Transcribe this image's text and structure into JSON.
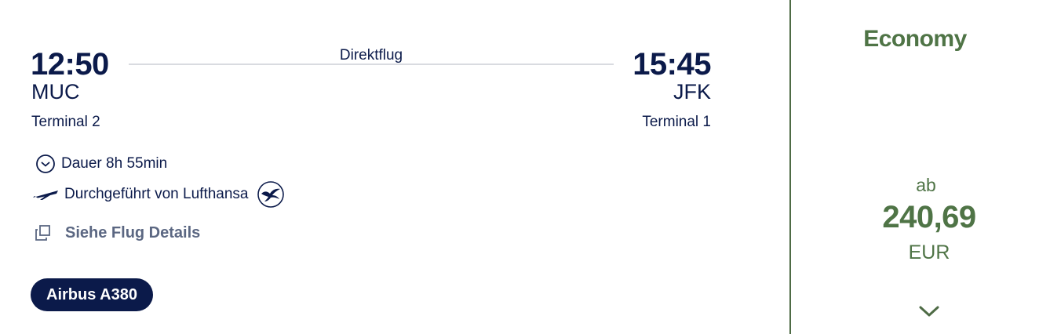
{
  "flight": {
    "departure": {
      "time": "12:50",
      "airport": "MUC",
      "terminal": "Terminal 2"
    },
    "arrival": {
      "time": "15:45",
      "airport": "JFK",
      "terminal": "Terminal 1"
    },
    "route_type": "Direktflug",
    "duration": "Dauer 8h 55min",
    "operator": "Durchgeführt von Lufthansa",
    "details_link": "Siehe Flug Details",
    "aircraft": "Airbus A380"
  },
  "fare": {
    "class": "Economy",
    "prefix": "ab",
    "amount": "240,69",
    "currency": "EUR"
  },
  "icons": {
    "clock": "clock-icon",
    "plane": "plane-icon",
    "airline_logo": "lufthansa-crane-icon",
    "copy": "copy-icon",
    "expand": "chevron-down-icon"
  },
  "colors": {
    "navy": "#0b1a4a",
    "fare_green": "#4f7446",
    "link_gray": "#5b6782",
    "route_line": "#d9dbe0"
  }
}
